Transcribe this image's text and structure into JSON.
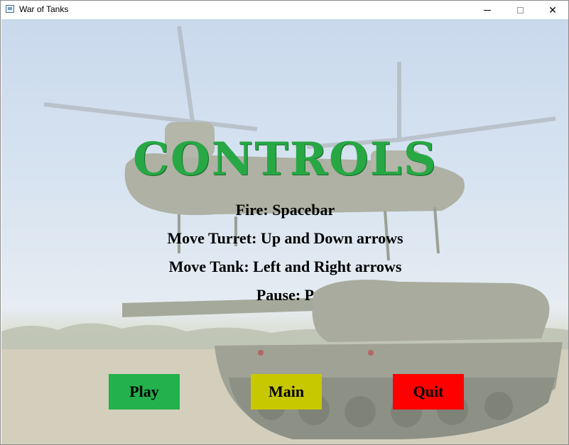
{
  "window": {
    "title": "War of Tanks",
    "minimize_icon": "minimize-icon",
    "maximize_icon": "maximize-icon",
    "close_icon": "close-icon",
    "close_glyph": "✕"
  },
  "screen": {
    "heading": "CONTROLS",
    "controls": [
      "Fire: Spacebar",
      "Move Turret: Up and Down arrows",
      "Move Tank: Left and Right arrows",
      "Pause: P"
    ],
    "heading_color": "#27a844"
  },
  "buttons": {
    "play": {
      "label": "Play",
      "color": "#22b14c"
    },
    "main": {
      "label": "Main",
      "color": "#c8c800"
    },
    "quit": {
      "label": "Quit",
      "color": "#ff0000"
    }
  },
  "background": {
    "description_icon": "helicopter-and-tank-image"
  }
}
